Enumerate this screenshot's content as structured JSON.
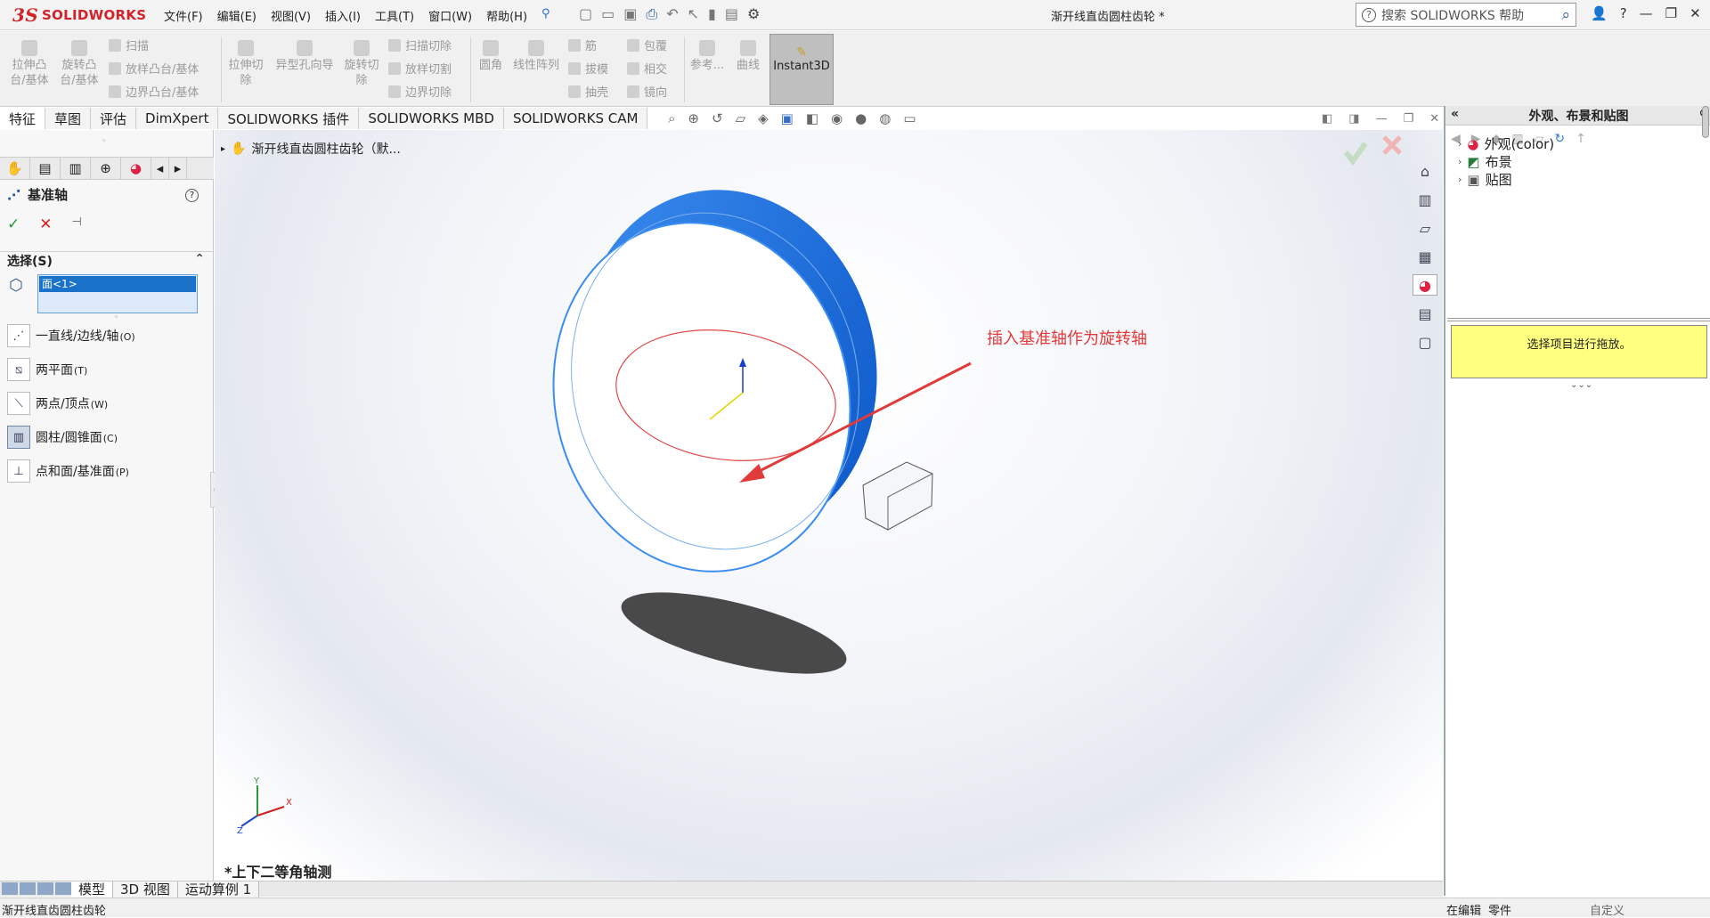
{
  "app": {
    "logo_text": "SOLIDWORKS",
    "logo_mark": "3S",
    "doc_title": "渐开线直齿圆柱齿轮 *",
    "search_placeholder": "搜索 SOLIDWORKS 帮助"
  },
  "menu": [
    "文件(F)",
    "编辑(E)",
    "视图(V)",
    "插入(I)",
    "工具(T)",
    "窗口(W)",
    "帮助(H)"
  ],
  "ribbon": {
    "extrude_boss": [
      "拉伸凸",
      "台/基体"
    ],
    "revolve_boss": [
      "旋转凸",
      "台/基体"
    ],
    "sweep": "扫描",
    "loft": "放样凸台/基体",
    "boundary": "边界凸台/基体",
    "extrude_cut": [
      "拉伸切",
      "除"
    ],
    "hole_wizard": "异型孔向导",
    "revolve_cut": [
      "旋转切",
      "除"
    ],
    "sweep_cut": "扫描切除",
    "loft_cut": "放样切割",
    "boundary_cut": "边界切除",
    "fillet": "圆角",
    "linear_pattern": "线性阵列",
    "rib": "筋",
    "draft": "拔模",
    "shell": "抽壳",
    "wrap": "包覆",
    "intersect": "相交",
    "mirror": "镜向",
    "reference": "参考...",
    "curves": "曲线",
    "instant3d": "Instant3D"
  },
  "tabs": [
    "特征",
    "草图",
    "评估",
    "DimXpert",
    "SOLIDWORKS 插件",
    "SOLIDWORKS MBD",
    "SOLIDWORKS CAM"
  ],
  "property_manager": {
    "title": "基准轴",
    "help": "?",
    "ok": "✓",
    "cancel": "✕",
    "pin": "⊣",
    "selection_header": "选择(S)",
    "selected_item": "面<1>",
    "options": [
      {
        "label": "一直线/边线/轴",
        "key": "(O)"
      },
      {
        "label": "两平面",
        "key": "(T)"
      },
      {
        "label": "两点/顶点",
        "key": "(W)"
      },
      {
        "label": "圆柱/圆锥面",
        "key": "(C)"
      },
      {
        "label": "点和面/基准面",
        "key": "(P)"
      }
    ]
  },
  "viewport": {
    "tree_item": "渐开线直齿圆柱齿轮（默...",
    "annotation": "插入基准轴作为旋转轴",
    "view_name": "*上下二等角轴测",
    "triad": {
      "x": "X",
      "y": "Y",
      "z": "Z"
    }
  },
  "task_pane": {
    "title": "外观、布景和贴图",
    "items": [
      "外观(color)",
      "布景",
      "贴图"
    ],
    "note": "选择项目进行拖放。"
  },
  "bottom_tabs": [
    "模型",
    "3D 视图",
    "运动算例 1"
  ],
  "status": {
    "left": "渐开线直齿圆柱齿轮",
    "editing": "在编辑",
    "part": "零件",
    "custom": "自定义"
  },
  "colors": {
    "accent_blue": "#1a73c9",
    "annotation_red": "#e03a3a",
    "note_yellow": "#ffff80",
    "brand_red": "#d2232a"
  }
}
